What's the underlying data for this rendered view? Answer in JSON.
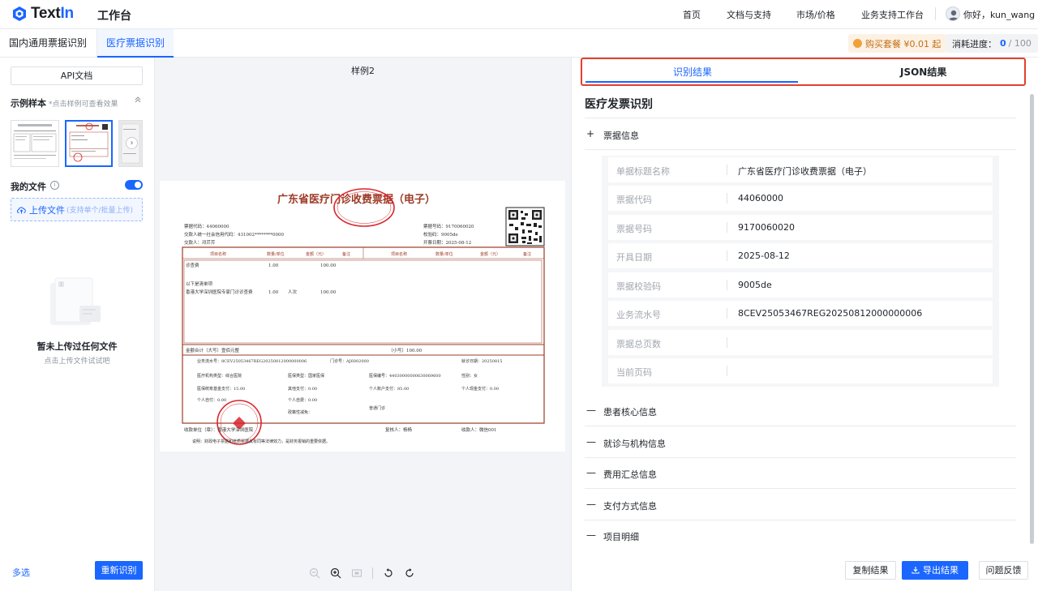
{
  "header": {
    "logo_text_main": "Text",
    "logo_text_accent": "In",
    "app_title": "工作台",
    "nav": [
      "首页",
      "文档与支持",
      "市场/价格",
      "业务支持工作台"
    ],
    "user_greeting": "你好，kun_wang"
  },
  "subbar": {
    "tabs": [
      {
        "label": "国内通用票据识别",
        "active": false
      },
      {
        "label": "医疗票据识别",
        "active": true
      }
    ],
    "buy_label": "购买套餐 ¥0.01 起",
    "usage_label": "消耗进度：",
    "usage_current": "0",
    "usage_total": "/ 100"
  },
  "left": {
    "api_button": "API文档",
    "samples_title": "示例样本",
    "samples_hint": "*点击样例可查看效果",
    "my_files": "我的文件",
    "upload_label": "上传文件",
    "upload_hint": "(支持单个/批量上传)",
    "empty_title": "暂未上传过任何文件",
    "empty_sub": "点击上传文件试试吧",
    "multi_select": "多选",
    "rerun": "重新识别"
  },
  "preview": {
    "sample_name": "样例2",
    "doc": {
      "title": "广东省医疗门诊收费票据（电子）",
      "left_meta": [
        "票据代码：44060000",
        "交款人统一社会信用代码：431002********0000",
        "交款人：邓芹芹"
      ],
      "right_meta": [
        "票据号码：9170060020",
        "校验码：9005de",
        "开票日期：2025-08-12"
      ],
      "col_headers": [
        "项目名称",
        "数量/单位",
        "金额（元）",
        "备注",
        "项目名称",
        "数量/单位",
        "金额（元）",
        "备注"
      ],
      "rows": [
        {
          "name": "诊查费",
          "qty": "1.00",
          "unit": "",
          "amount": "100.00"
        },
        {
          "name": "以下是清单项",
          "qty": "",
          "unit": "",
          "amount": ""
        },
        {
          "name": "香港大学深圳医院专家门诊诊查费",
          "qty": "1.00",
          "unit": "人次",
          "amount": "100.00"
        }
      ],
      "total_caps": "金额合计（大写）壹佰元整",
      "total_small": "（小写）100.00",
      "other_lines": [
        "业务流水号：8CEV25053467REG20250812000000006",
        "门诊号：AJ6002000",
        "就诊日期：20250815",
        "医疗机构类型：综合医院",
        "医保类型：国家医保",
        "医保编号：44030000000630069600",
        "性别：女",
        "医保统筹基金支付：15.00",
        "其他支付：0.00",
        "个人账户支付：85.00",
        "个人现金支付：0.00",
        "个人自付：0.00",
        "个人自费：0.00",
        "普通门诊",
        "政策性减免："
      ],
      "footer": [
        "收款单位（章）：香港大学深圳医院",
        "复核人：杨杨",
        "收款人：微信001"
      ],
      "note": "说明：财政电子票据和纸质票据具有同等法律效力，是财务报销的重要依据。"
    }
  },
  "right": {
    "tabs": [
      "识别结果",
      "JSON结果"
    ],
    "title": "医疗发票识别",
    "sections": [
      {
        "sym": "+",
        "label": "票据信息"
      },
      {
        "sym": "—",
        "label": "患者核心信息"
      },
      {
        "sym": "—",
        "label": "就诊与机构信息"
      },
      {
        "sym": "—",
        "label": "费用汇总信息"
      },
      {
        "sym": "—",
        "label": "支付方式信息"
      },
      {
        "sym": "—",
        "label": "项目明细"
      }
    ],
    "fields": [
      {
        "k": "单据标题名称",
        "v": "广东省医疗门诊收费票据（电子）"
      },
      {
        "k": "票据代码",
        "v": "44060000"
      },
      {
        "k": "票据号码",
        "v": "9170060020"
      },
      {
        "k": "开具日期",
        "v": "2025-08-12"
      },
      {
        "k": "票据校验码",
        "v": "9005de"
      },
      {
        "k": "业务流水号",
        "v": "8CEV25053467REG20250812000000006"
      },
      {
        "k": "票据总页数",
        "v": ""
      },
      {
        "k": "当前页码",
        "v": ""
      }
    ],
    "buttons": {
      "copy": "复制结果",
      "export": "导出结果",
      "feedback": "问题反馈"
    }
  },
  "colors": {
    "accent": "#1a66ff",
    "highlight_border": "#e2412e",
    "stamp_red": "#d8262d",
    "invoice_brown": "#9c3b26"
  }
}
